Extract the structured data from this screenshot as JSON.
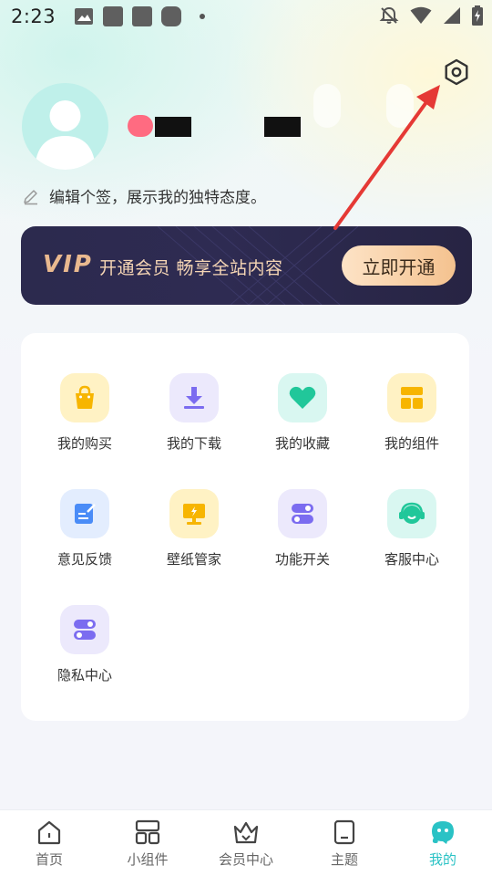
{
  "status_bar": {
    "time": "2:23"
  },
  "profile": {
    "signature": "编辑个签，展示我的独特态度。"
  },
  "vip_banner": {
    "logo": "VIP",
    "text": "开通会员  畅享全站内容",
    "button_label": "立即开通"
  },
  "menu": {
    "items": [
      {
        "label": "我的购买",
        "icon": "shopping-bag-icon",
        "bg": "#fff2c4",
        "color": "#f7b500"
      },
      {
        "label": "我的下载",
        "icon": "download-icon",
        "bg": "#ece9fc",
        "color": "#7b6cf0"
      },
      {
        "label": "我的收藏",
        "icon": "heart-icon",
        "bg": "#d9f7f1",
        "color": "#21c79a"
      },
      {
        "label": "我的组件",
        "icon": "widget-icon",
        "bg": "#fff2c4",
        "color": "#f7b500"
      },
      {
        "label": "意见反馈",
        "icon": "feedback-icon",
        "bg": "#e3edfe",
        "color": "#4a8cf7"
      },
      {
        "label": "壁纸管家",
        "icon": "wallpaper-icon",
        "bg": "#fff2c4",
        "color": "#f7b500"
      },
      {
        "label": "功能开关",
        "icon": "toggle-icon",
        "bg": "#ece9fc",
        "color": "#7b6cf0"
      },
      {
        "label": "客服中心",
        "icon": "headset-icon",
        "bg": "#d9f7f1",
        "color": "#21c79a"
      },
      {
        "label": "隐私中心",
        "icon": "privacy-toggle-icon",
        "bg": "#ece9fc",
        "color": "#7b6cf0"
      }
    ]
  },
  "bottom_nav": {
    "items": [
      {
        "label": "首页",
        "icon": "home-icon"
      },
      {
        "label": "小组件",
        "icon": "widgets-icon"
      },
      {
        "label": "会员中心",
        "icon": "crown-icon"
      },
      {
        "label": "主题",
        "icon": "phone-theme-icon"
      },
      {
        "label": "我的",
        "icon": "mascot-icon",
        "active": true
      }
    ]
  },
  "colors": {
    "accent": "#2ac2c5",
    "vip_gold": "#e9b98f",
    "annotation_arrow": "#e53935"
  }
}
